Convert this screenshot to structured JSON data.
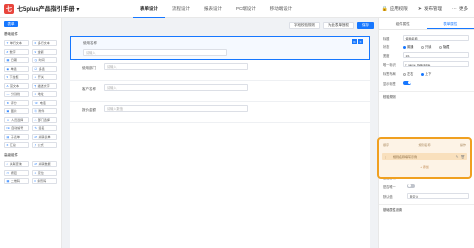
{
  "header": {
    "logo_char": "七",
    "app_title": "七5plus产品指引手册",
    "dropdown_glyph": "▾",
    "tabs": [
      {
        "label": "表单设计",
        "active": true
      },
      {
        "label": "流程设计",
        "active": false
      },
      {
        "label": "报表设计",
        "active": false
      },
      {
        "label": "PC端设计",
        "active": false
      },
      {
        "label": "移动端设计",
        "active": false
      }
    ],
    "actions": [
      {
        "label": "应用权限",
        "icon": "lock-icon",
        "glyph": "🔒"
      },
      {
        "label": "发布管理",
        "icon": "send-icon",
        "glyph": "➤"
      },
      {
        "label": "更多",
        "icon": "more-icon",
        "glyph": "⋯"
      }
    ]
  },
  "sidebar": {
    "tab_label": "表单",
    "basic_title": "基础组件",
    "basic_items": [
      {
        "label": "单行文本",
        "glyph": "T"
      },
      {
        "label": "多行文本",
        "glyph": "≡"
      },
      {
        "label": "数字",
        "glyph": "#"
      },
      {
        "label": "金额",
        "glyph": "¥"
      },
      {
        "label": "日期",
        "glyph": "▦"
      },
      {
        "label": "时间",
        "glyph": "◷"
      },
      {
        "label": "单选",
        "glyph": "◉"
      },
      {
        "label": "多选",
        "glyph": "☑"
      },
      {
        "label": "下拉框",
        "glyph": "▾"
      },
      {
        "label": "开关",
        "glyph": "◐"
      },
      {
        "label": "富文本",
        "glyph": "A"
      },
      {
        "label": "描述文字",
        "glyph": "¶"
      },
      {
        "label": "分割线",
        "glyph": "—"
      },
      {
        "label": "地址",
        "glyph": "⌖"
      },
      {
        "label": "评分",
        "glyph": "★"
      },
      {
        "label": "电话",
        "glyph": "☏"
      },
      {
        "label": "图片",
        "glyph": "▣"
      },
      {
        "label": "附件",
        "glyph": "⎘"
      },
      {
        "label": "人员选择",
        "glyph": "☺"
      },
      {
        "label": "部门选择",
        "glyph": "⌂"
      },
      {
        "label": "自动编号",
        "glyph": "№"
      },
      {
        "label": "签名",
        "glyph": "✎"
      },
      {
        "label": "子表单",
        "glyph": "▤"
      },
      {
        "label": "关联表单",
        "glyph": "⇄"
      },
      {
        "label": "汇总",
        "glyph": "Σ"
      },
      {
        "label": "公式",
        "glyph": "ƒ"
      }
    ],
    "advanced_title": "高级组件",
    "advanced_items": [
      {
        "label": "关联查询",
        "glyph": "⌕"
      },
      {
        "label": "关联数据",
        "glyph": "⇄"
      },
      {
        "label": "按钮",
        "glyph": "▭"
      },
      {
        "label": "定位",
        "glyph": "⌖"
      },
      {
        "label": "二维码",
        "glyph": "▦"
      },
      {
        "label": "条形码",
        "glyph": "‖"
      }
    ]
  },
  "toolbar": {
    "buttons": [
      {
        "label": "字段校验规则",
        "primary": false
      },
      {
        "label": "为此表单授权",
        "primary": false
      },
      {
        "label": "保存",
        "primary": true
      }
    ]
  },
  "canvas": {
    "fields": [
      {
        "label": "使用名称",
        "placeholder": "请输入",
        "active": true,
        "tools": [
          "⧉",
          "✕"
        ]
      },
      {
        "label": "使用部门",
        "placeholder": "请输入",
        "active": false
      },
      {
        "label": "客户名称",
        "placeholder": "请输入",
        "active": false
      },
      {
        "label": "报价金额",
        "placeholder": "请输入数值",
        "active": false
      }
    ]
  },
  "right_panel": {
    "tabs": [
      {
        "label": "组件属性",
        "active": false
      },
      {
        "label": "表单属性",
        "active": true
      }
    ],
    "title_label": "标题",
    "title_value": "使用名称",
    "status_label": "状态",
    "status_options": [
      {
        "label": "普通",
        "checked": true
      },
      {
        "label": "只读",
        "checked": false
      },
      {
        "label": "隐藏",
        "checked": false
      }
    ],
    "width_label": "宽度",
    "width_value": "1/1",
    "id_label": "唯一标识",
    "id_value": "f_name_8a9c2d4e",
    "layout_label": "标签布局",
    "layout_options": [
      {
        "label": "左右",
        "checked": false
      },
      {
        "label": "上下",
        "checked": true
      }
    ],
    "show_label": "显示标签",
    "show_label_on": true,
    "rules_title": "校验规则",
    "rules_table": {
      "col_order": "顺序",
      "col_name": "规则名称",
      "col_action": "操作",
      "row_name": "规则名称填写示例",
      "row_tools": [
        "✎",
        "🗑"
      ],
      "add_label": "+ 添加"
    },
    "required_label": "是否必填",
    "required_on": true,
    "unique_label": "是否唯一",
    "unique_on": false,
    "default_label": "默认值",
    "default_value": "自定义",
    "lower_title": "基础属性设置"
  }
}
